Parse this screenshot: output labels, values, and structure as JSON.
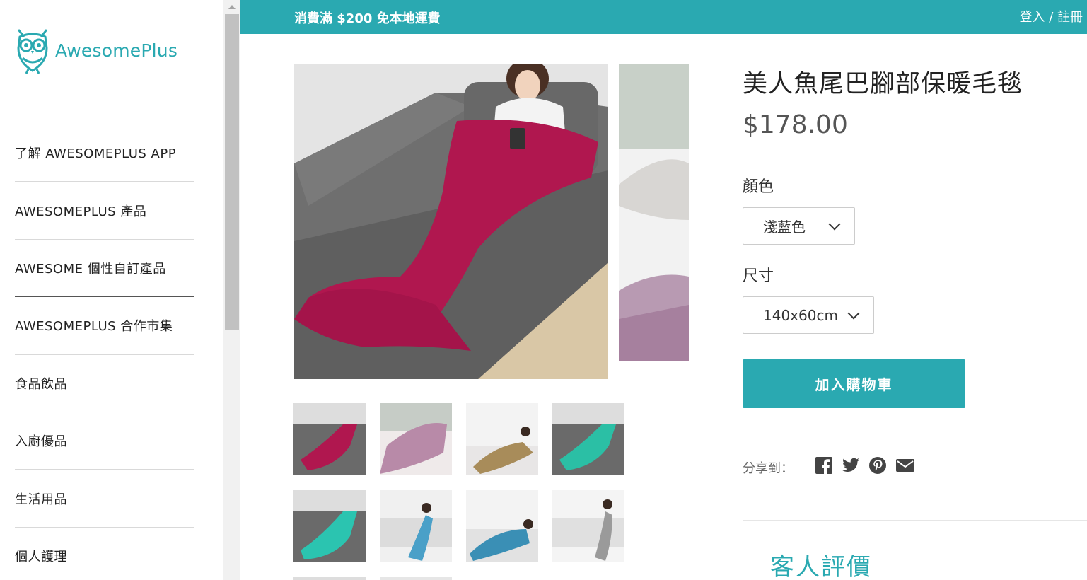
{
  "brand": {
    "name": "AwesomePlus",
    "accent": "#2aa9b1"
  },
  "topbar": {
    "promo": "消費滿 $200 免本地運費",
    "login": "登入 / 註冊"
  },
  "sidebar": {
    "items": [
      {
        "label": "了解 AWESOMEPLUS APP"
      },
      {
        "label": "AWESOMEPLUS 產品"
      },
      {
        "label": "AWESOME 個性自訂產品"
      },
      {
        "label": "AWESOMEPLUS 合作市集"
      },
      {
        "label": "食品飲品"
      },
      {
        "label": "入廚優品"
      },
      {
        "label": "生活用品"
      },
      {
        "label": "個人護理"
      }
    ]
  },
  "product": {
    "title": "美人魚尾巴腳部保暖毛毯",
    "price": "$178.00",
    "color_label": "顏色",
    "color_value": "淺藍色",
    "size_label": "尺寸",
    "size_value": "140x60cm",
    "add_to_cart": "加入購物車",
    "share_label": "分享到：",
    "share_icons": [
      "facebook-icon",
      "twitter-icon",
      "pinterest-icon",
      "email-icon"
    ],
    "reviews_title": "客人評價",
    "thumbnails": [
      {
        "color": "#b0174f"
      },
      {
        "color": "#b88aa8"
      },
      {
        "color": "#a88c5a"
      },
      {
        "color": "#2bbfa5"
      },
      {
        "color": "#2bc4b0"
      },
      {
        "color": "#4aa0c8"
      },
      {
        "color": "#3a8fb5"
      },
      {
        "color": "#9a9a9a"
      }
    ]
  }
}
